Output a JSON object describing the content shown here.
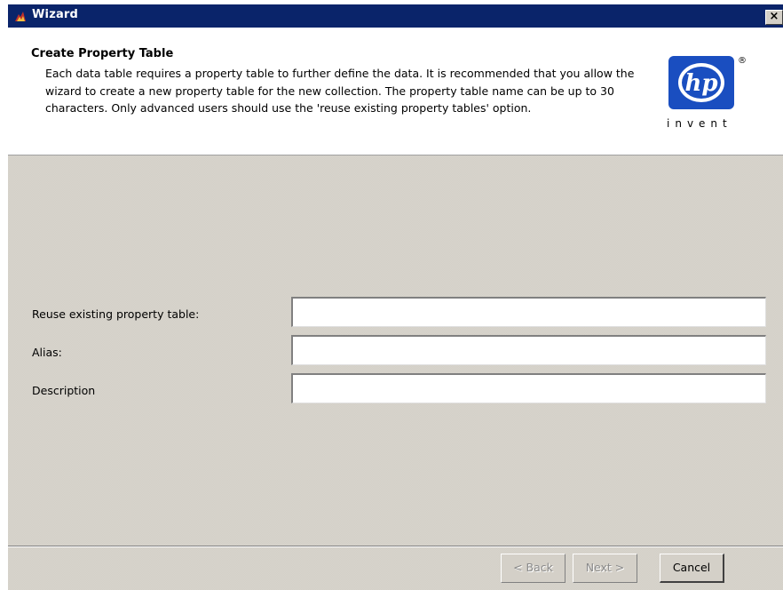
{
  "window": {
    "title": "Wizard",
    "close_label": "×"
  },
  "header": {
    "title": "Create Property Table",
    "description": "Each data table requires a property table to further define the data. It is recommended that you allow the wizard to create a new property table for the new collection. The property table name can be up to 30 characters. Only advanced users should use the 'reuse existing property tables' option.",
    "logo_text": "invent",
    "logo_mark": "hp",
    "logo_reg": "®"
  },
  "form": {
    "fields": [
      {
        "label": "Reuse existing property table:",
        "value": ""
      },
      {
        "label": "Alias:",
        "value": ""
      },
      {
        "label": "Description",
        "value": ""
      }
    ]
  },
  "buttons": {
    "back": "< Back",
    "next": "Next >",
    "cancel": "Cancel"
  },
  "colors": {
    "titlebar": "#0a246a",
    "dialog_bg": "#d4d0c8",
    "logo_blue": "#1a4ec0"
  }
}
